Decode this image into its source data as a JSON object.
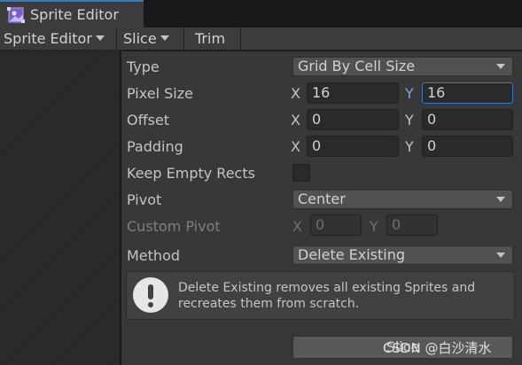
{
  "tab": {
    "title": "Sprite Editor",
    "icon": "sprite-editor-icon"
  },
  "toolbar": {
    "mode_label": "Sprite Editor",
    "slice_label": "Slice",
    "trim_label": "Trim"
  },
  "slice_panel": {
    "type_label": "Type",
    "type_value": "Grid By Cell Size",
    "pixel_size": {
      "label": "Pixel Size",
      "x_axis": "X",
      "x_value": "16",
      "y_axis": "Y",
      "y_value": "16"
    },
    "offset": {
      "label": "Offset",
      "x_axis": "X",
      "x_value": "0",
      "y_axis": "Y",
      "y_value": "0"
    },
    "padding": {
      "label": "Padding",
      "x_axis": "X",
      "x_value": "0",
      "y_axis": "Y",
      "y_value": "0"
    },
    "keep_empty_rects_label": "Keep Empty Rects",
    "keep_empty_rects_checked": false,
    "pivot_label": "Pivot",
    "pivot_value": "Center",
    "custom_pivot": {
      "label": "Custom Pivot",
      "x_axis": "X",
      "x_value": "0",
      "y_axis": "Y",
      "y_value": "0"
    },
    "method_label": "Method",
    "method_value": "Delete Existing",
    "help_text": "Delete Existing removes all existing Sprites and recreates them from scratch.",
    "slice_button_label": "Slice"
  },
  "watermark": "CSDN @白沙清水",
  "colors": {
    "accent": "#3a79bb",
    "panel_bg": "#383838",
    "field_bg": "#2a2a2a"
  }
}
